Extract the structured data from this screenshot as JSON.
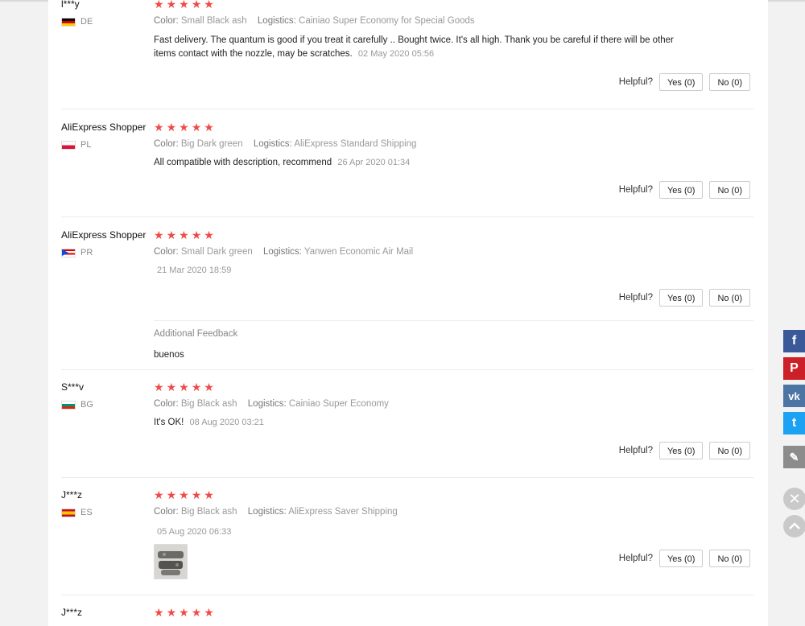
{
  "reviews": [
    {
      "name": "l***y",
      "country": "DE",
      "stars": 5,
      "color_key": "Color:",
      "color": "Small Black ash",
      "logistics_key": "Logistics:",
      "logistics": "Cainiao Super Economy for Special Goods",
      "text": "Fast delivery. The quantum is good if you treat it carefully .. Bought twice. It's all high. Thank you be careful if there will be other items contact with the nozzle, may be scratches.",
      "date": "02 May 2020 05:56",
      "helpful_label": "Helpful?",
      "yes": "Yes (0)",
      "no": "No (0)"
    },
    {
      "name": "AliExpress Shopper",
      "country": "PL",
      "stars": 5,
      "color_key": "Color:",
      "color": "Big Dark green",
      "logistics_key": "Logistics:",
      "logistics": "AliExpress Standard Shipping",
      "text": "All compatible with description, recommend",
      "date": "26 Apr 2020 01:34",
      "helpful_label": "Helpful?",
      "yes": "Yes (0)",
      "no": "No (0)"
    },
    {
      "name": "AliExpress Shopper",
      "country": "PR",
      "stars": 5,
      "color_key": "Color:",
      "color": "Small Dark green",
      "logistics_key": "Logistics:",
      "logistics": "Yanwen Economic Air Mail",
      "text": "",
      "date": "21 Mar 2020 18:59",
      "helpful_label": "Helpful?",
      "yes": "Yes (0)",
      "no": "No (0)",
      "additional_label": "Additional Feedback",
      "additional_text": "buenos"
    },
    {
      "name": "S***v",
      "country": "BG",
      "stars": 5,
      "color_key": "Color:",
      "color": "Big Black ash",
      "logistics_key": "Logistics:",
      "logistics": "Cainiao Super Economy",
      "text": "It's OK!",
      "date": "08 Aug 2020 03:21",
      "helpful_label": "Helpful?",
      "yes": "Yes (0)",
      "no": "No (0)"
    },
    {
      "name": "J***z",
      "country": "ES",
      "stars": 5,
      "color_key": "Color:",
      "color": "Big Black ash",
      "logistics_key": "Logistics:",
      "logistics": "AliExpress Saver Shipping",
      "text": "",
      "date": "05 Aug 2020 06:33",
      "helpful_label": "Helpful?",
      "yes": "Yes (0)",
      "no": "No (0)"
    },
    {
      "name": "J***z",
      "stars": 5
    }
  ],
  "social": {
    "facebook": "f",
    "pinterest": "P",
    "vk": "vk",
    "twitter": "t",
    "edit": "✎"
  },
  "colors": {
    "star": "#f04a48",
    "facebook": "#3b5998",
    "pinterest": "#cb2027",
    "vk": "#4c75a3",
    "twitter": "#1da1f2",
    "edit": "#8c8c8c"
  }
}
